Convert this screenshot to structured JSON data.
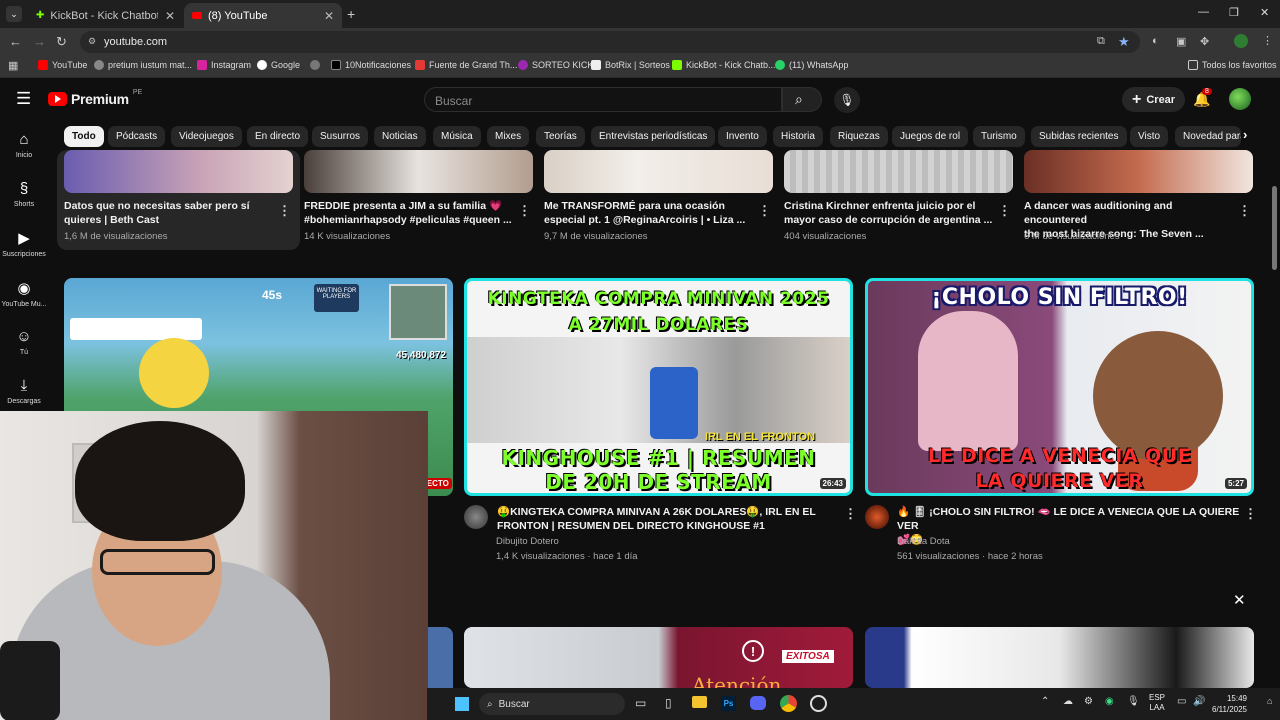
{
  "browser": {
    "tabs": [
      {
        "title": "KickBot - Kick Chatbot, Alerts, T",
        "active": false
      },
      {
        "title": "(8) YouTube",
        "active": true
      }
    ],
    "url": "youtube.com",
    "bookmarks": [
      "YouTube",
      "pretium iustum mat...",
      "Instagram",
      "Google",
      "",
      "10Notificaciones",
      "Fuente de Grand Th...",
      "SORTEO KICK",
      "BotRix | Sorteos",
      "KickBot - Kick Chatb...",
      "(11) WhatsApp"
    ],
    "all_favorites": "Todos los favoritos"
  },
  "youtube": {
    "logo": "Premium",
    "logo_region": "PE",
    "search_placeholder": "Buscar",
    "create_label": "Crear",
    "notif_count": "8",
    "chips": [
      "Todo",
      "Pódcasts",
      "Videojuegos",
      "En directo",
      "Susurros",
      "Noticias",
      "Música",
      "Mixes",
      "Teorías",
      "Entrevistas periodísticas",
      "Invento",
      "Historia",
      "Riquezas",
      "Juegos de rol",
      "Turismo",
      "Subidas recientes",
      "Visto",
      "Novedad para"
    ],
    "sidebar": [
      "Inicio",
      "Shorts",
      "Suscripciones",
      "YouTube Mu...",
      "Tú",
      "Descargas"
    ]
  },
  "row1": [
    {
      "title1": "Datos que no necesitas saber pero sí",
      "title2": "quieres | Beth Cast",
      "meta": "1,6 M de visualizaciones"
    },
    {
      "title1": "FREDDIE presenta a JIM a su familia 💗",
      "title2": "#bohemianrhapsody #peliculas #queen ...",
      "meta": "14 K visualizaciones"
    },
    {
      "title1": "Me TRANSFORMÉ para una ocasión",
      "title2": "especial pt. 1 @ReginaArcoiris | • Liza ...",
      "meta": "9,7 M de visualizaciones"
    },
    {
      "title1": "Cristina Kirchner enfrenta juicio por el",
      "title2": "mayor caso de corrupción de argentina ...",
      "meta": "404 visualizaciones"
    },
    {
      "title1": "A dancer was auditioning and encountered",
      "title2": "the most bizarre song: The Seven ...",
      "meta": "6 M de visualizaciones"
    }
  ],
  "row2": {
    "game": {
      "waiting": "WAITING FOR PLAYERS",
      "timer": "45s",
      "score": "45,480,872",
      "badge": "DIRECTO"
    },
    "kingteka": {
      "top1": "KINGTEKA COMPRA MINIVAN 2025",
      "top2": "A 27MIL DOLARES",
      "irl": "IRL EN EL FRONTON",
      "bottom1": "KINGHOUSE #1 | RESUMEN",
      "bottom2": "DE 20H DE STREAM",
      "duration": "26:43",
      "title1": "🤑KINGTEKA COMPRA MINIVAN A 26K DOLARES🤑, IRL EN EL",
      "title2": "FRONTON |  RESUMEN DEL DIRECTO KINGHOUSE #1",
      "channel": "Dibujito Dotero",
      "meta": "1,4 K visualizaciones · hace 1 día"
    },
    "cholo": {
      "top": "¡CHOLO SIN FILTRO!",
      "bottom1": "LE DICE A VENECIA QUE",
      "bottom2": "LA QUIERE VER",
      "duration": "5:27",
      "title1": "🔥 🎚 ¡CHOLO SIN FILTRO! 🫦 LE DICE A VENECIA QUE LA QUIERE VER",
      "title2": "💕😳",
      "channel": "Dakota Dota",
      "meta": "561 visualizaciones · hace 2 horas"
    }
  },
  "row3": {
    "exitosa": "EXITOSA",
    "atencion": "Atención"
  },
  "taskbar": {
    "search": "Buscar",
    "lang1": "ESP",
    "lang2": "LAA",
    "time": "15:49",
    "date": "6/11/2025"
  }
}
